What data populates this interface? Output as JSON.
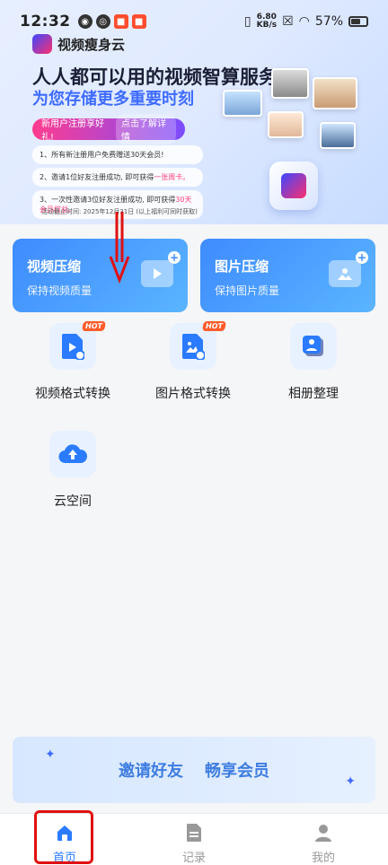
{
  "status_bar": {
    "time": "12:32",
    "network_speed": "6.80",
    "network_unit": "KB/s",
    "battery": "57%"
  },
  "banner": {
    "brand": "视频瘦身云",
    "headline": "人人都可以用的视频智算服务",
    "subheadline": "为您存储更多重要时刻",
    "promo_left": "新用户注册享好礼!",
    "promo_right": "点击了解详情",
    "rules": [
      "1、所有新注册用户免费赠送30天会员!",
      "2、邀请1位好友注册成功, 即可获得",
      "3、一次性邀请3位好友注册成功, 即可获得"
    ],
    "rule2_highlight": "一张周卡。",
    "rule3_highlight": "30天会员权益。",
    "deadline": "活动截止时间: 2025年12月31日 (以上福利可同时获取)"
  },
  "cards": [
    {
      "title": "视频压缩",
      "subtitle": "保持视频质量",
      "icon": "video-compress-icon"
    },
    {
      "title": "图片压缩",
      "subtitle": "保持图片质量",
      "icon": "image-compress-icon"
    }
  ],
  "tools": [
    {
      "label": "视频格式转换",
      "icon": "video-file-icon",
      "badge": "HOT"
    },
    {
      "label": "图片格式转换",
      "icon": "image-file-icon",
      "badge": "HOT"
    },
    {
      "label": "相册整理",
      "icon": "album-icon",
      "badge": ""
    },
    {
      "label": "云空间",
      "icon": "cloud-upload-icon",
      "badge": ""
    }
  ],
  "invite": {
    "left": "邀请好友",
    "right": "畅享会员"
  },
  "nav": [
    {
      "label": "首页",
      "icon": "home-icon"
    },
    {
      "label": "记录",
      "icon": "document-icon"
    },
    {
      "label": "我的",
      "icon": "user-icon"
    }
  ],
  "colors": {
    "accent": "#2a7bff",
    "card_gradient_start": "#3e8bff",
    "promo_pink": "#ff3c8f",
    "annotation_red": "#e01010"
  }
}
